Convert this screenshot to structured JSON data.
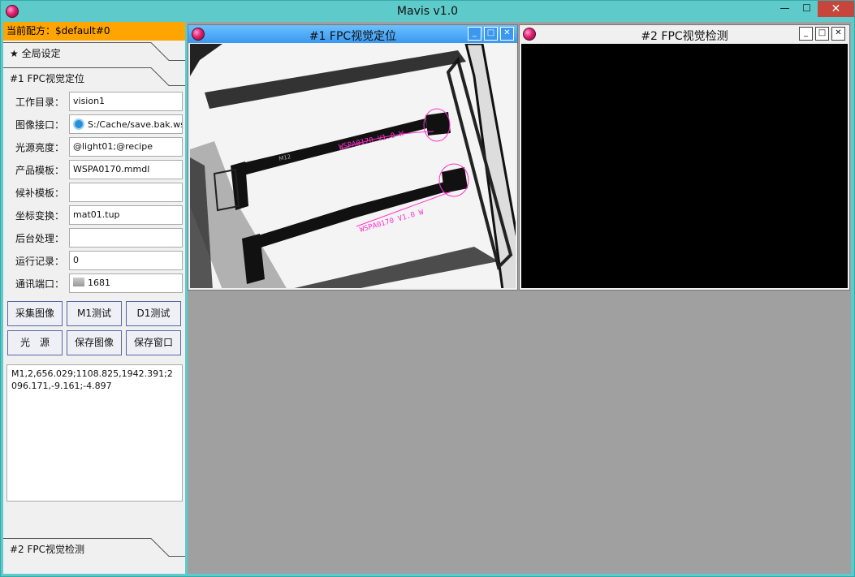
{
  "app": {
    "title": "Mavis v1.0",
    "min_glyph": "—",
    "max_glyph": "☐",
    "close_glyph": "✕"
  },
  "left": {
    "recipe": "当前配方：$default#0",
    "global_tab": "★ 全局设定",
    "section1_tab": "#1 FPC视觉定位",
    "section2_tab": "#2 FPC视觉检测",
    "fields": [
      {
        "label": "工作目录：",
        "value": "vision1",
        "icon": ""
      },
      {
        "label": "图像接口：",
        "value": "S:/Cache/save.bak.wsp",
        "icon": "camera-icon"
      },
      {
        "label": "光源亮度：",
        "value": "@light01;@recipe",
        "icon": ""
      },
      {
        "label": "产品模板：",
        "value": "WSPA0170.mmdl",
        "icon": ""
      },
      {
        "label": "候补模板：",
        "value": "",
        "icon": ""
      },
      {
        "label": "坐标变换：",
        "value": "mat01.tup",
        "icon": ""
      },
      {
        "label": "后台处理：",
        "value": "",
        "icon": ""
      },
      {
        "label": "运行记录：",
        "value": "0",
        "icon": ""
      },
      {
        "label": "通讯端口：",
        "value": "1681",
        "icon": "network-port-icon"
      }
    ],
    "buttons": [
      {
        "id": "capture",
        "label": "采集图像"
      },
      {
        "id": "m1test",
        "label": "M1测试"
      },
      {
        "id": "d1test",
        "label": "D1测试"
      },
      {
        "id": "light",
        "label": "光　源"
      },
      {
        "id": "saveimg",
        "label": "保存图像"
      },
      {
        "id": "savewin",
        "label": "保存窗口"
      }
    ],
    "log": "M1,2,656.029;1108.825,1942.391;2096.171,-9.161;-4.897"
  },
  "subwindows": [
    {
      "title": "#1 FPC视觉定位",
      "active": true,
      "image": "fpc-camera-image",
      "overlay_text": [
        "WSPA0170 V1.0 W",
        "WSPA0170 V1.0 W",
        "M12"
      ]
    },
    {
      "title": "#2 FPC视觉检测",
      "active": false,
      "image": "black-empty-view"
    }
  ],
  "colors": {
    "recipe_bar": "#ffa400",
    "title_bar": "#5ecaca",
    "active_subwin": "#3a98f0",
    "workspace": "#a0a0a0",
    "overlay": "#ff33cc"
  }
}
